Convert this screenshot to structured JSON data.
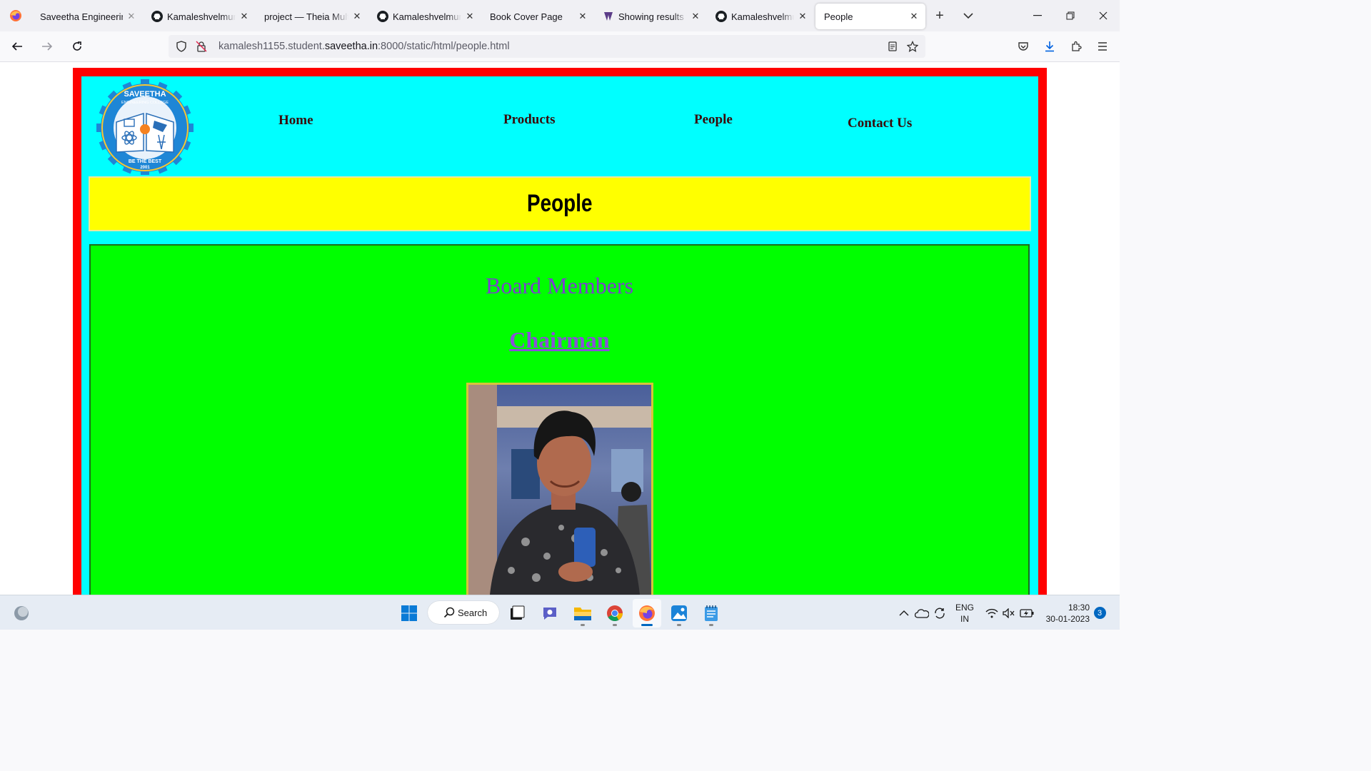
{
  "browser": {
    "tabs": [
      {
        "title": "Saveetha Engineering C",
        "icon": "saveetha-favicon",
        "active": false
      },
      {
        "title": "Kamaleshvelmurugan",
        "icon": "github-icon",
        "active": false
      },
      {
        "title": "project — Theia Multi-",
        "icon": "none",
        "active": false
      },
      {
        "title": "Kamaleshvelmurugan",
        "icon": "github-icon",
        "active": false
      },
      {
        "title": "Book Cover Page",
        "icon": "none",
        "active": false
      },
      {
        "title": "Showing results for",
        "icon": "search-favicon",
        "active": false
      },
      {
        "title": "Kamaleshvelmurugan",
        "icon": "github-icon",
        "active": false
      },
      {
        "title": "People",
        "icon": "none",
        "active": true
      }
    ],
    "url": {
      "prefix": "kamalesh1155.student.",
      "host": "saveetha.in",
      "suffix": ":8000/static/html/people.html"
    }
  },
  "page": {
    "menu": {
      "home": "Home",
      "products": "Products",
      "people": "People",
      "contact": "Contact Us"
    },
    "logo": {
      "top_text": "SAVEETHA",
      "sub_text": "ENGINEERING COLLEGE",
      "motto": "BE THE BEST",
      "year": "2001"
    },
    "banner_title": "People",
    "section_title": "Board Members",
    "role_title": "Chairman",
    "colors": {
      "frame": "#ff0000",
      "background": "#00ffff",
      "banner": "#ffff00",
      "content": "#00ff00",
      "heading": "#7b3fd0"
    }
  },
  "taskbar": {
    "search_label": "Search",
    "language": "ENG",
    "region": "IN",
    "time": "18:30",
    "date": "30-01-2023",
    "notification_count": "3",
    "pinned": [
      "windows-start-icon",
      "search-icon",
      "task-view-icon",
      "teams-chat-icon",
      "file-explorer-icon",
      "chrome-icon",
      "firefox-icon",
      "photos-icon",
      "notepad-icon"
    ]
  }
}
